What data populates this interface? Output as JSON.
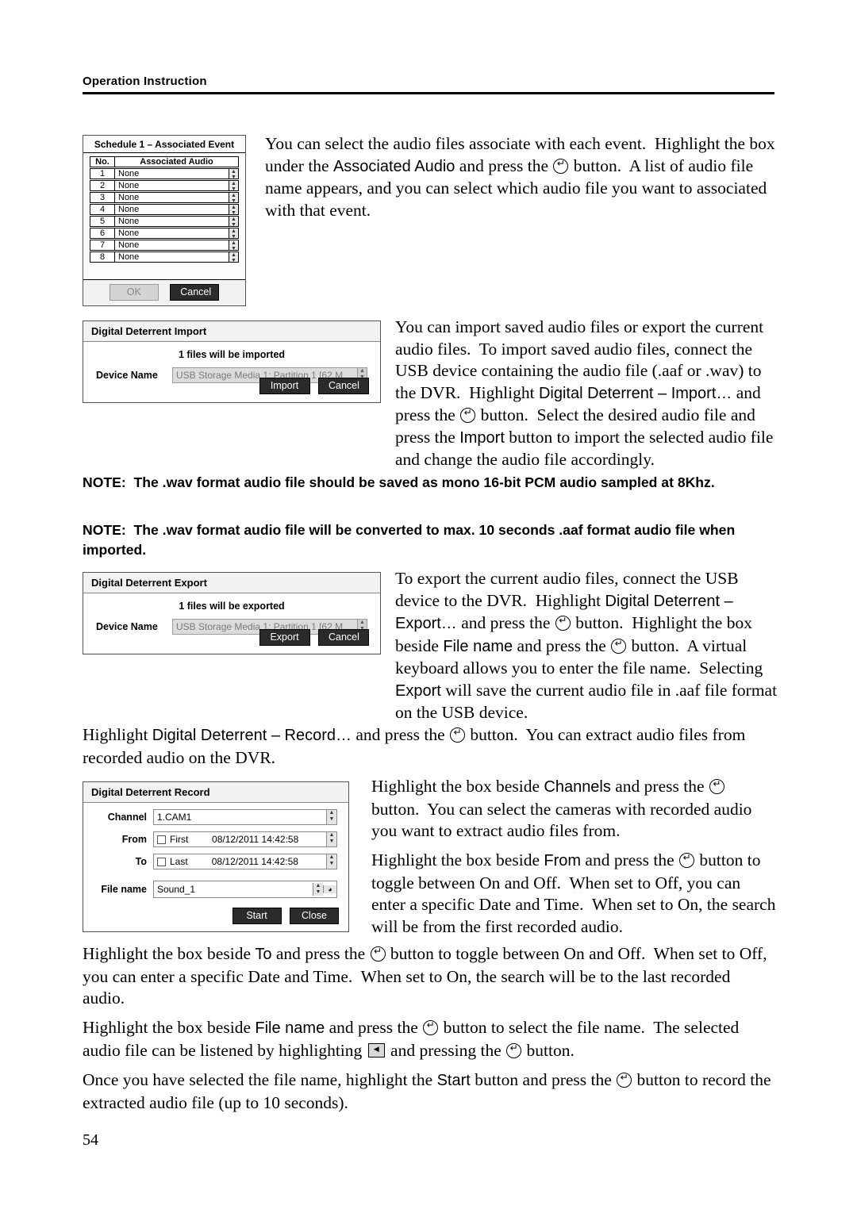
{
  "header": {
    "title": "Operation Instruction"
  },
  "page_number": "54",
  "paragraphs": {
    "p1": "You can select the audio files associate with each event.  Highlight the box under the Associated Audio and press the Ⓔ button.  A list of audio file name appears, and you can select which audio file you want to associated with that event.",
    "p2": "You can import saved audio files or export the current audio files.  To import saved audio files, connect the USB device containing the audio file (.aaf or .wav) to the DVR.  Highlight Digital Deterrent – Import… and press the Ⓔ button.  Select the desired audio file and press the Import button to import the selected audio file and change the audio file accordingly.",
    "note1": "NOTE:  The .wav format audio file should be saved as mono 16-bit PCM audio sampled at 8Khz.",
    "note2": "NOTE:  The .wav format audio file will be converted to max. 10 seconds .aaf format audio file when imported.",
    "p3": "To export the current audio files, connect the USB device to the DVR.  Highlight Digital Deterrent – Export… and press the Ⓔ button.  Highlight the box beside File name and press the Ⓔ button.  A virtual keyboard allows you to enter the file name.  Selecting Export will save the current audio file in .aaf file format on the USB device.",
    "p4": "Highlight Digital Deterrent – Record… and press the Ⓔ button.  You can extract audio files from recorded audio on the DVR.",
    "p5": "Highlight the box beside Channels and press the Ⓔ button.  You can select the cameras with recorded audio you want to extract audio files from.",
    "p6": "Highlight the box beside From and press the Ⓔ button to toggle between On and Off.  When set to Off, you can enter a specific Date and Time.  When set to On, the search will be from the first recorded audio.",
    "p7": "Highlight the box beside To and press the Ⓔ button to toggle between On and Off.  When set to Off, you can enter a specific Date and Time.  When set to On, the search will be to the last recorded audio.",
    "p8": "Highlight the box beside File name and press the Ⓔ button to select the file name.  The selected audio file can be listened by highlighting ◀ and pressing the Ⓔ button.",
    "p9": "Once you have selected the file name, highlight the Start button and press the Ⓔ button to record the extracted audio file (up to 10 seconds)."
  },
  "dialogs": {
    "schedule": {
      "title": "Schedule 1 – Associated Event",
      "col_no": "No.",
      "col_audio": "Associated Audio",
      "rows": [
        {
          "no": "1",
          "value": "None"
        },
        {
          "no": "2",
          "value": "None"
        },
        {
          "no": "3",
          "value": "None"
        },
        {
          "no": "4",
          "value": "None"
        },
        {
          "no": "5",
          "value": "None"
        },
        {
          "no": "6",
          "value": "None"
        },
        {
          "no": "7",
          "value": "None"
        },
        {
          "no": "8",
          "value": "None"
        }
      ],
      "ok_label": "OK",
      "cancel_label": "Cancel"
    },
    "import": {
      "title": "Digital Deterrent Import",
      "message": "1 files will be imported",
      "device_label": "Device Name",
      "device_value": "USB Storage Media    1: Partition 1 [62 M…",
      "primary_label": "Import",
      "cancel_label": "Cancel"
    },
    "export": {
      "title": "Digital Deterrent Export",
      "message": "1 files will be exported",
      "device_label": "Device Name",
      "device_value": "USB Storage Media    1: Partition 1 [62 M…",
      "primary_label": "Export",
      "cancel_label": "Cancel"
    },
    "record": {
      "title": "Digital Deterrent Record",
      "channel_label": "Channel",
      "channel_value": "1.CAM1",
      "from_label": "From",
      "from_check_label": "First",
      "from_value": "08/12/2011  14:42:58",
      "to_label": "To",
      "to_check_label": "Last",
      "to_value": "08/12/2011  14:42:58",
      "filename_label": "File name",
      "filename_value": "Sound_1",
      "start_label": "Start",
      "close_label": "Close"
    }
  }
}
